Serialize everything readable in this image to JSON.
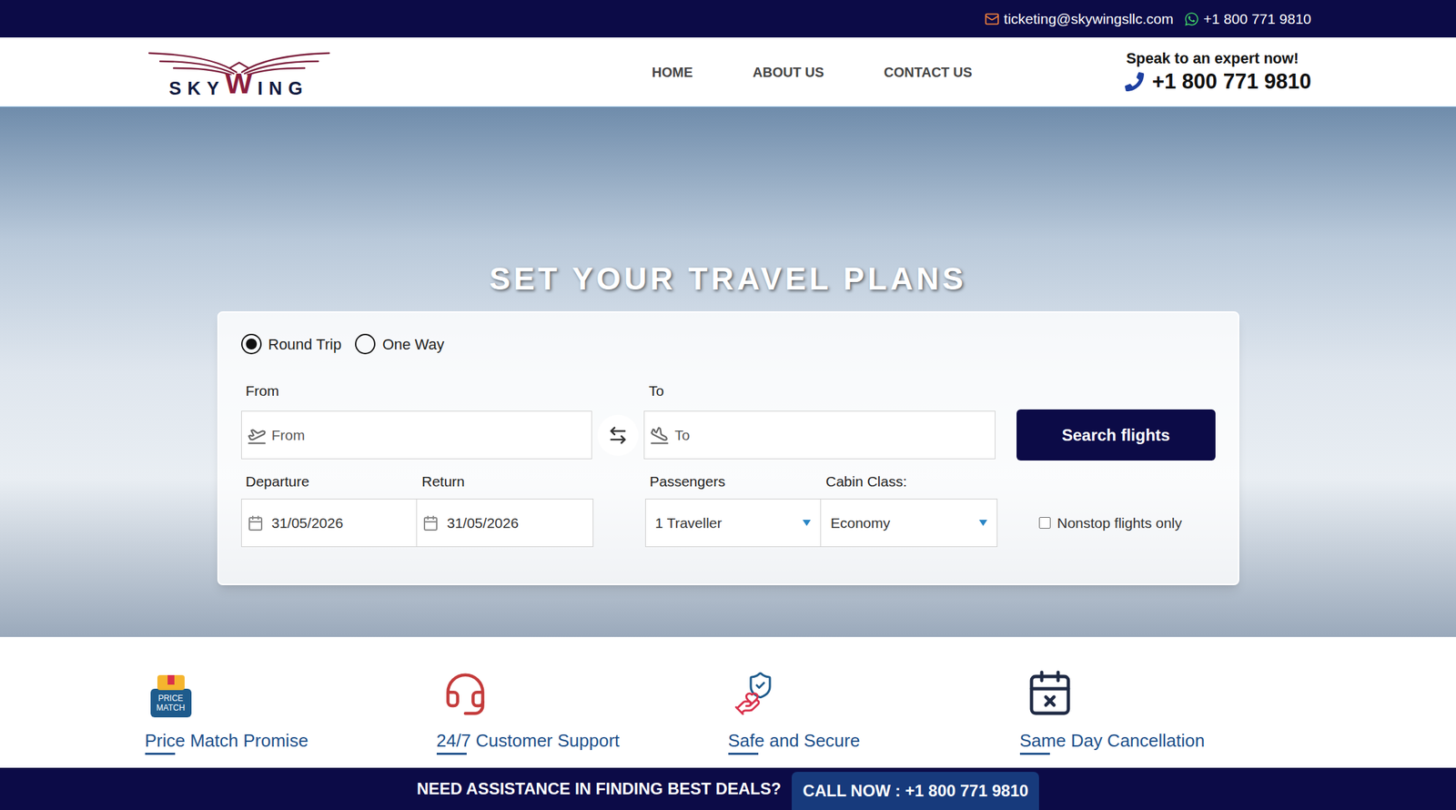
{
  "top_bar": {
    "email": "ticketing@skywingsllc.com",
    "phone": "+1 800 771 9810"
  },
  "header": {
    "logo": {
      "before": "SKY",
      "mark": "W",
      "after": "ING"
    },
    "nav": [
      {
        "label": "HOME"
      },
      {
        "label": "ABOUT US"
      },
      {
        "label": "CONTACT US"
      }
    ],
    "expert": {
      "label": "Speak to an expert now!",
      "phone": "+1 800 771 9810"
    }
  },
  "hero": {
    "title": "SET YOUR TRAVEL PLANS"
  },
  "search": {
    "trip_types": [
      {
        "label": "Round Trip",
        "selected": true
      },
      {
        "label": "One Way",
        "selected": false
      }
    ],
    "from": {
      "label": "From",
      "placeholder": "From"
    },
    "to": {
      "label": "To",
      "placeholder": "To"
    },
    "departure": {
      "label": "Departure",
      "value": "31/05/2026"
    },
    "return": {
      "label": "Return",
      "value": "31/05/2026"
    },
    "passengers": {
      "label": "Passengers",
      "value": "1 Traveller"
    },
    "cabin": {
      "label": "Cabin Class:",
      "value": "Economy"
    },
    "button": "Search flights",
    "nonstop": {
      "label": "Nonstop flights only",
      "checked": false
    }
  },
  "features": [
    {
      "title": "Price Match Promise",
      "icon_lines": [
        "PRICE",
        "MATCH"
      ]
    },
    {
      "title": "24/7 Customer Support",
      "icon_lines": []
    },
    {
      "title": "Safe and Secure",
      "icon_lines": []
    },
    {
      "title": "Same Day Cancellation",
      "icon_lines": []
    }
  ],
  "bottom_bar": {
    "text": "NEED ASSISTANCE IN FINDING BEST DEALS?",
    "button": "CALL NOW : +1 800 771 9810"
  }
}
